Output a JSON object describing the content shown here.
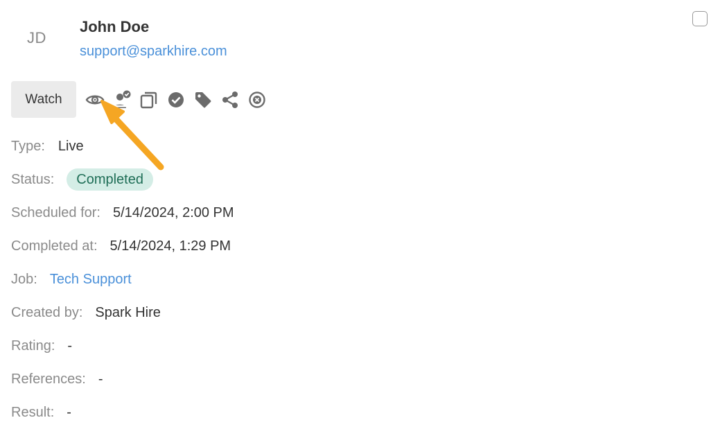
{
  "candidate": {
    "initials": "JD",
    "name": "John Doe",
    "email": "support@sparkhire.com"
  },
  "toolbar": {
    "watch_label": "Watch",
    "icons": [
      "eye-icon",
      "person-check-icon",
      "copy-icon",
      "check-circle-icon",
      "tag-icon",
      "share-icon",
      "close-circle-icon"
    ]
  },
  "details": {
    "type": {
      "label": "Type:",
      "value": "Live"
    },
    "status": {
      "label": "Status:",
      "value": "Completed"
    },
    "scheduled": {
      "label": "Scheduled for:",
      "value": "5/14/2024, 2:00 PM"
    },
    "completed": {
      "label": "Completed at:",
      "value": "5/14/2024, 1:29 PM"
    },
    "job": {
      "label": "Job:",
      "value": "Tech Support"
    },
    "created_by": {
      "label": "Created by:",
      "value": "Spark Hire"
    },
    "rating": {
      "label": "Rating:",
      "value": "-"
    },
    "references": {
      "label": "References:",
      "value": "-"
    },
    "result": {
      "label": "Result:",
      "value": "-"
    }
  },
  "colors": {
    "link": "#4a90d9",
    "icon": "#6b6b6b",
    "badge_bg": "#d4ede6",
    "badge_text": "#1f6e57",
    "arrow": "#f5a623"
  }
}
